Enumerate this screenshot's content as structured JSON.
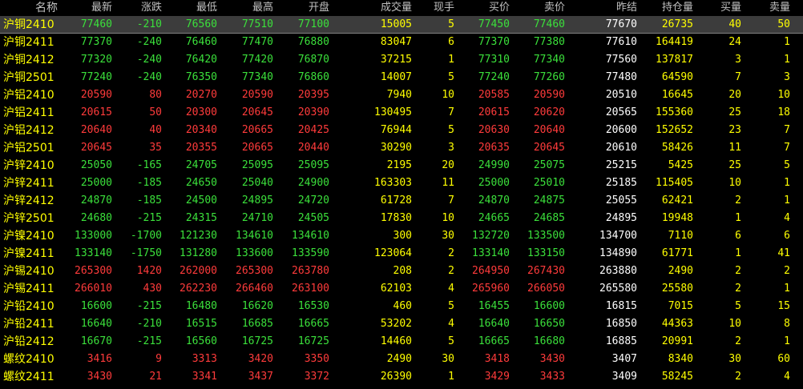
{
  "colors": {
    "up": "#ff3b3b",
    "down": "#3be03b",
    "neutral": "#ffffff",
    "name": "#ffff00",
    "header": "#c0c0c0",
    "selected_row_bg": "#3c3c3c",
    "background": "#000000"
  },
  "columns": {
    "name": "名称",
    "last": "最新",
    "change": "涨跌",
    "low": "最低",
    "high": "最高",
    "open": "开盘",
    "volume": "成交量",
    "cur": "现手",
    "bid": "买价",
    "ask": "卖价",
    "prev": "昨结",
    "oi": "持仓量",
    "bidq": "买量",
    "askq": "卖量"
  },
  "rows": [
    {
      "name": "沪铜2410",
      "last": "77460",
      "change": "-210",
      "low": "76560",
      "high": "77510",
      "open": "77100",
      "volume": "15005",
      "cur": "5",
      "bid": "77450",
      "ask": "77460",
      "prev": "77670",
      "oi": "26735",
      "bidq": "40",
      "askq": "50",
      "dir": "down"
    },
    {
      "name": "沪铜2411",
      "last": "77370",
      "change": "-240",
      "low": "76460",
      "high": "77470",
      "open": "76880",
      "volume": "83047",
      "cur": "6",
      "bid": "77370",
      "ask": "77380",
      "prev": "77610",
      "oi": "164419",
      "bidq": "24",
      "askq": "1",
      "dir": "down"
    },
    {
      "name": "沪铜2412",
      "last": "77320",
      "change": "-240",
      "low": "76420",
      "high": "77420",
      "open": "76870",
      "volume": "37215",
      "cur": "1",
      "bid": "77310",
      "ask": "77340",
      "prev": "77560",
      "oi": "137817",
      "bidq": "3",
      "askq": "1",
      "dir": "down"
    },
    {
      "name": "沪铜2501",
      "last": "77240",
      "change": "-240",
      "low": "76350",
      "high": "77340",
      "open": "76860",
      "volume": "14007",
      "cur": "5",
      "bid": "77240",
      "ask": "77260",
      "prev": "77480",
      "oi": "64590",
      "bidq": "7",
      "askq": "3",
      "dir": "down"
    },
    {
      "name": "沪铝2410",
      "last": "20590",
      "change": "80",
      "low": "20270",
      "high": "20590",
      "open": "20395",
      "volume": "7940",
      "cur": "10",
      "bid": "20585",
      "ask": "20590",
      "prev": "20510",
      "oi": "16645",
      "bidq": "20",
      "askq": "10",
      "dir": "up"
    },
    {
      "name": "沪铝2411",
      "last": "20615",
      "change": "50",
      "low": "20300",
      "high": "20645",
      "open": "20390",
      "volume": "130495",
      "cur": "7",
      "bid": "20615",
      "ask": "20620",
      "prev": "20565",
      "oi": "155360",
      "bidq": "25",
      "askq": "18",
      "dir": "up"
    },
    {
      "name": "沪铝2412",
      "last": "20640",
      "change": "40",
      "low": "20340",
      "high": "20665",
      "open": "20425",
      "volume": "76944",
      "cur": "5",
      "bid": "20630",
      "ask": "20640",
      "prev": "20600",
      "oi": "152652",
      "bidq": "23",
      "askq": "7",
      "dir": "up"
    },
    {
      "name": "沪铝2501",
      "last": "20645",
      "change": "35",
      "low": "20355",
      "high": "20665",
      "open": "20440",
      "volume": "30290",
      "cur": "3",
      "bid": "20635",
      "ask": "20645",
      "prev": "20610",
      "oi": "58426",
      "bidq": "11",
      "askq": "7",
      "dir": "up"
    },
    {
      "name": "沪锌2410",
      "last": "25050",
      "change": "-165",
      "low": "24705",
      "high": "25095",
      "open": "25095",
      "volume": "2195",
      "cur": "20",
      "bid": "24990",
      "ask": "25075",
      "prev": "25215",
      "oi": "5425",
      "bidq": "25",
      "askq": "5",
      "dir": "down"
    },
    {
      "name": "沪锌2411",
      "last": "25000",
      "change": "-185",
      "low": "24650",
      "high": "25040",
      "open": "24900",
      "volume": "163303",
      "cur": "11",
      "bid": "25000",
      "ask": "25010",
      "prev": "25185",
      "oi": "115405",
      "bidq": "10",
      "askq": "1",
      "dir": "down"
    },
    {
      "name": "沪锌2412",
      "last": "24870",
      "change": "-185",
      "low": "24500",
      "high": "24895",
      "open": "24720",
      "volume": "61728",
      "cur": "7",
      "bid": "24870",
      "ask": "24875",
      "prev": "25055",
      "oi": "62421",
      "bidq": "2",
      "askq": "1",
      "dir": "down"
    },
    {
      "name": "沪锌2501",
      "last": "24680",
      "change": "-215",
      "low": "24315",
      "high": "24710",
      "open": "24505",
      "volume": "17830",
      "cur": "10",
      "bid": "24665",
      "ask": "24685",
      "prev": "24895",
      "oi": "19948",
      "bidq": "1",
      "askq": "4",
      "dir": "down"
    },
    {
      "name": "沪镍2410",
      "last": "133000",
      "change": "-1700",
      "low": "121230",
      "high": "134610",
      "open": "134610",
      "volume": "300",
      "cur": "30",
      "bid": "132720",
      "ask": "133500",
      "prev": "134700",
      "oi": "7110",
      "bidq": "6",
      "askq": "6",
      "dir": "down"
    },
    {
      "name": "沪镍2411",
      "last": "133140",
      "change": "-1750",
      "low": "131280",
      "high": "133600",
      "open": "133590",
      "volume": "123064",
      "cur": "2",
      "bid": "133140",
      "ask": "133150",
      "prev": "134890",
      "oi": "61771",
      "bidq": "1",
      "askq": "41",
      "dir": "down"
    },
    {
      "name": "沪锡2410",
      "last": "265300",
      "change": "1420",
      "low": "262000",
      "high": "265300",
      "open": "263780",
      "volume": "208",
      "cur": "2",
      "bid": "264950",
      "ask": "267430",
      "prev": "263880",
      "oi": "2490",
      "bidq": "2",
      "askq": "2",
      "dir": "up"
    },
    {
      "name": "沪锡2411",
      "last": "266010",
      "change": "430",
      "low": "262230",
      "high": "266460",
      "open": "263100",
      "volume": "62103",
      "cur": "4",
      "bid": "265960",
      "ask": "266050",
      "prev": "265580",
      "oi": "25580",
      "bidq": "2",
      "askq": "1",
      "dir": "up"
    },
    {
      "name": "沪铅2410",
      "last": "16600",
      "change": "-215",
      "low": "16480",
      "high": "16620",
      "open": "16530",
      "volume": "460",
      "cur": "5",
      "bid": "16455",
      "ask": "16600",
      "prev": "16815",
      "oi": "7015",
      "bidq": "5",
      "askq": "15",
      "dir": "down"
    },
    {
      "name": "沪铅2411",
      "last": "16640",
      "change": "-210",
      "low": "16515",
      "high": "16685",
      "open": "16665",
      "volume": "53202",
      "cur": "4",
      "bid": "16640",
      "ask": "16650",
      "prev": "16850",
      "oi": "44363",
      "bidq": "10",
      "askq": "8",
      "dir": "down"
    },
    {
      "name": "沪铅2412",
      "last": "16670",
      "change": "-215",
      "low": "16560",
      "high": "16725",
      "open": "16725",
      "volume": "14460",
      "cur": "5",
      "bid": "16665",
      "ask": "16680",
      "prev": "16885",
      "oi": "20991",
      "bidq": "2",
      "askq": "1",
      "dir": "down"
    },
    {
      "name": "螺纹2410",
      "last": "3416",
      "change": "9",
      "low": "3313",
      "high": "3420",
      "open": "3350",
      "volume": "2490",
      "cur": "30",
      "bid": "3418",
      "ask": "3430",
      "prev": "3407",
      "oi": "8340",
      "bidq": "30",
      "askq": "60",
      "dir": "up"
    },
    {
      "name": "螺纹2411",
      "last": "3430",
      "change": "21",
      "low": "3341",
      "high": "3437",
      "open": "3372",
      "volume": "26390",
      "cur": "1",
      "bid": "3429",
      "ask": "3433",
      "prev": "3409",
      "oi": "58245",
      "bidq": "2",
      "askq": "4",
      "dir": "up"
    }
  ]
}
